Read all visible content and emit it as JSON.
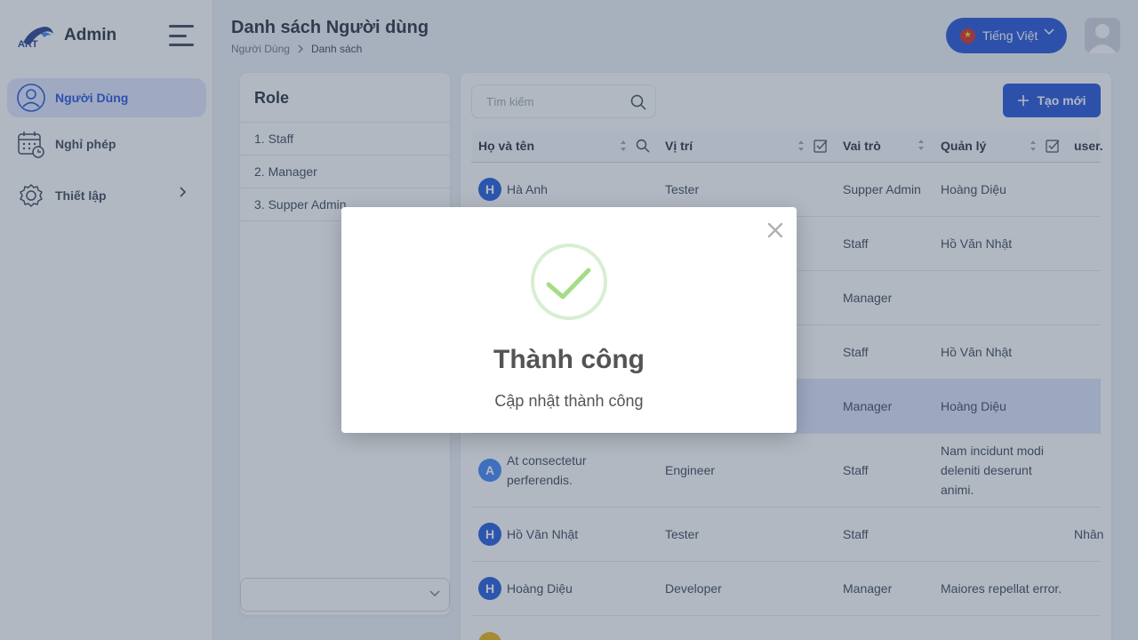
{
  "app": {
    "name": "Admin"
  },
  "sidebar": {
    "items": [
      {
        "label": "Người Dùng"
      },
      {
        "label": "Nghỉ phép"
      },
      {
        "label": "Thiết lập"
      }
    ]
  },
  "header": {
    "title": "Danh sách Người dùng",
    "breadcrumb": [
      "Người Dùng",
      "Danh sách"
    ],
    "language": "Tiếng Việt"
  },
  "roles": {
    "title": "Role",
    "items": [
      "1. Staff",
      "2. Manager",
      "3. Supper Admin"
    ]
  },
  "toolbar": {
    "search_placeholder": "Tìm kiếm",
    "create_label": "Tạo mới"
  },
  "table": {
    "columns": [
      "Họ và tên",
      "Vị trí",
      "Vai trò",
      "Quản lý",
      "user."
    ],
    "rows": [
      {
        "initial": "H",
        "name": "Hà Anh",
        "position": "Tester",
        "role": "Supper Admin",
        "manager": "Hoàng Diệu",
        "user": ""
      },
      {
        "initial": "",
        "name": "",
        "position": "",
        "role": "Staff",
        "manager": "Hồ Văn Nhật",
        "user": ""
      },
      {
        "initial": "",
        "name": "",
        "position": "",
        "role": "Manager",
        "manager": "",
        "user": ""
      },
      {
        "initial": "",
        "name": "",
        "position": "",
        "role": "Staff",
        "manager": "Hồ Văn Nhật",
        "user": ""
      },
      {
        "initial": "",
        "name": "",
        "position": "",
        "role": "Manager",
        "manager": "Hoàng Diệu",
        "user": ""
      },
      {
        "initial": "A",
        "name": "At consectetur perferendis.",
        "position": "Engineer",
        "role": "Staff",
        "manager": "Nam incidunt modi deleniti deserunt animi.",
        "user": ""
      },
      {
        "initial": "H",
        "name": "Hồ Văn Nhật",
        "position": "Tester",
        "role": "Staff",
        "manager": "",
        "user": "Nhân"
      },
      {
        "initial": "H",
        "name": "Hoàng Diệu",
        "position": "Developer",
        "role": "Manager",
        "manager": "Maiores repellat error.",
        "user": ""
      }
    ]
  },
  "modal": {
    "title": "Thành công",
    "message": "Cập nhật thành công"
  },
  "colors": {
    "primary": "#1d4ed8",
    "avatar_blue": "#1a56db",
    "avatar_light_blue": "#3b82f6",
    "avatar_yellow": "#eab308",
    "success": "#a5dc86",
    "overlay": "rgba(70,85,110,0.42)"
  }
}
